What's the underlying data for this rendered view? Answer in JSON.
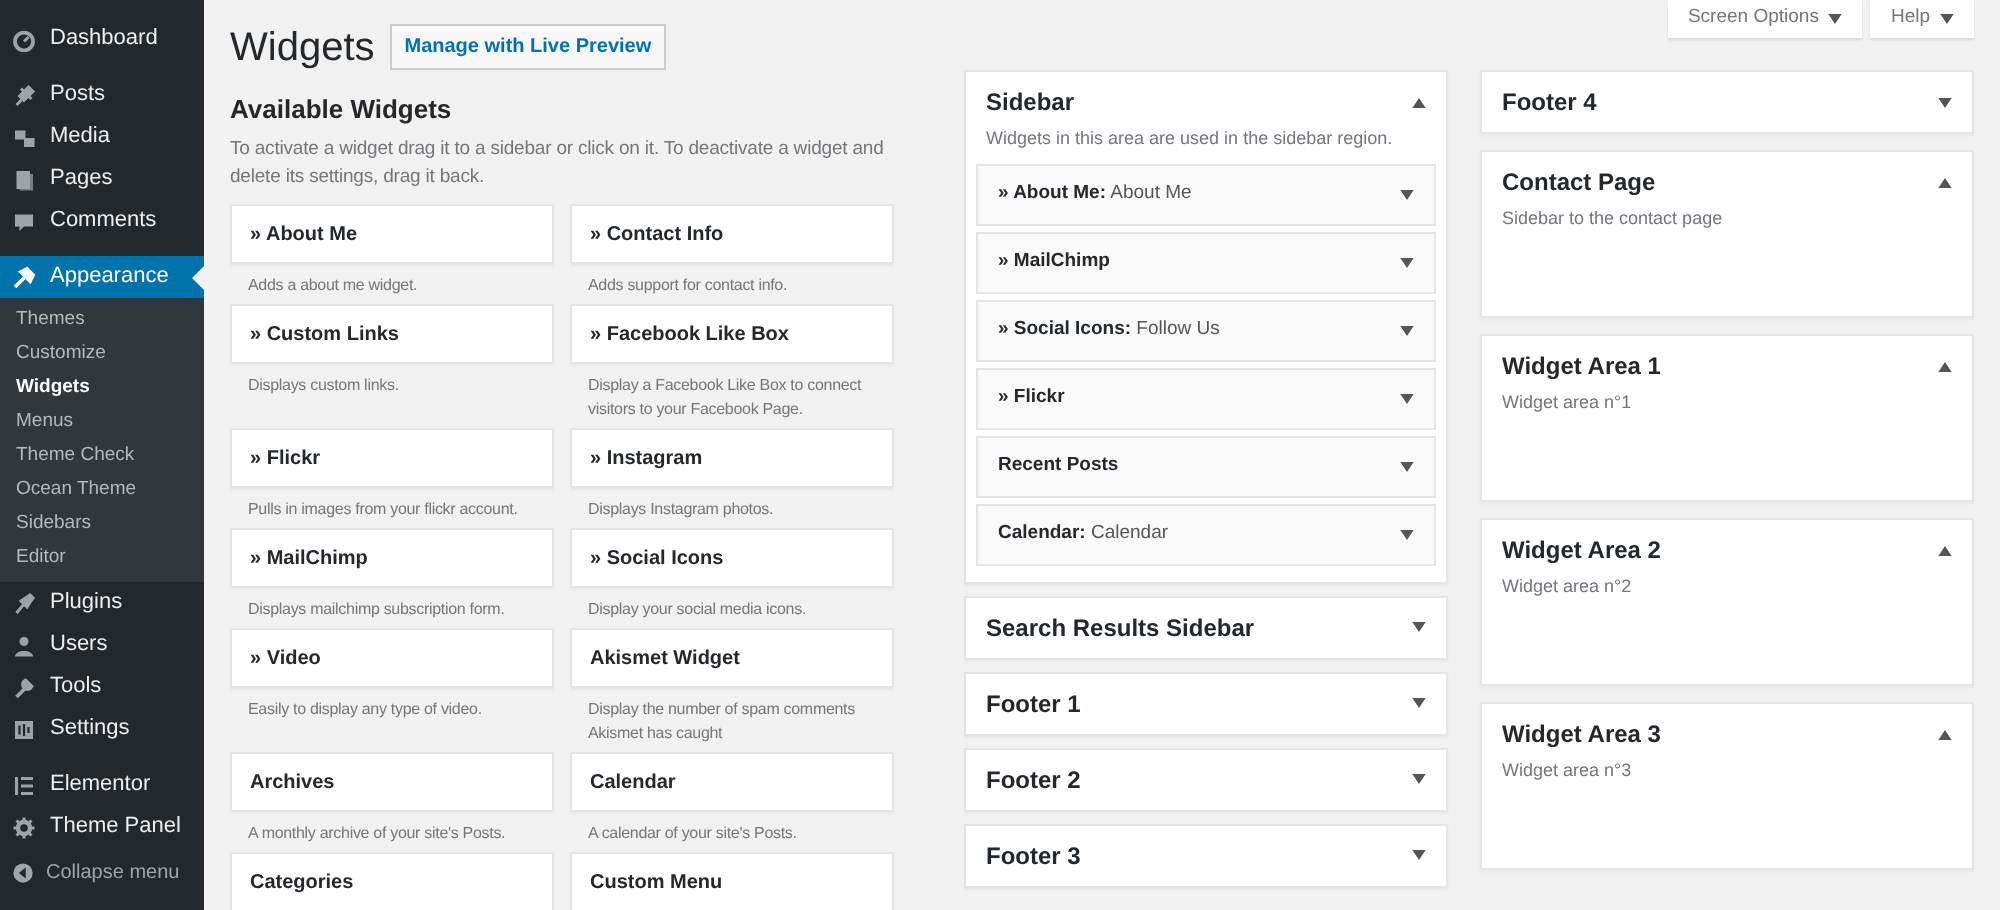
{
  "admin_menu": {
    "groups": [
      [
        {
          "label": "Dashboard",
          "selected": false
        }
      ],
      [
        {
          "label": "Posts",
          "selected": false
        },
        {
          "label": "Media",
          "selected": false
        },
        {
          "label": "Pages",
          "selected": false
        },
        {
          "label": "Comments",
          "selected": false
        }
      ],
      [
        {
          "label": "Appearance",
          "selected": true,
          "submenu": [
            {
              "label": "Themes",
              "selected": false
            },
            {
              "label": "Customize",
              "selected": false
            },
            {
              "label": "Widgets",
              "selected": true
            },
            {
              "label": "Menus",
              "selected": false
            },
            {
              "label": "Theme Check",
              "selected": false
            },
            {
              "label": "Ocean Theme",
              "selected": false
            },
            {
              "label": "Sidebars",
              "selected": false
            },
            {
              "label": "Editor",
              "selected": false
            }
          ]
        },
        {
          "label": "Plugins",
          "selected": false
        },
        {
          "label": "Users",
          "selected": false
        },
        {
          "label": "Tools",
          "selected": false
        },
        {
          "label": "Settings",
          "selected": false
        }
      ],
      [
        {
          "label": "Elementor",
          "selected": false
        },
        {
          "label": "Theme Panel",
          "selected": false
        }
      ]
    ],
    "collapse": "Collapse menu"
  },
  "screen_tabs": [
    "Screen Options",
    "Help"
  ],
  "page_title": "Widgets",
  "live_preview_button": "Manage with Live Preview",
  "available_widgets": {
    "title": "Available Widgets",
    "description": "To activate a widget drag it to a sidebar or click on it. To deactivate a widget and delete its settings, drag it back.",
    "widgets": [
      {
        "name": "» About Me",
        "description": "Adds a about me widget."
      },
      {
        "name": "» Contact Info",
        "description": "Adds support for contact info."
      },
      {
        "name": "» Custom Links",
        "description": "Displays custom links."
      },
      {
        "name": "» Facebook Like Box",
        "description": "Display a Facebook Like Box to connect visitors to your Facebook Page."
      },
      {
        "name": "» Flickr",
        "description": "Pulls in images from your flickr account."
      },
      {
        "name": "» Instagram",
        "description": "Displays Instagram photos."
      },
      {
        "name": "» MailChimp",
        "description": "Displays mailchimp subscription form."
      },
      {
        "name": "» Social Icons",
        "description": "Display your social media icons."
      },
      {
        "name": "» Video",
        "description": "Easily to display any type of video."
      },
      {
        "name": "Akismet Widget",
        "description": "Display the number of spam comments Akismet has caught"
      },
      {
        "name": "Archives",
        "description": "A monthly archive of your site's Posts."
      },
      {
        "name": "Calendar",
        "description": "A calendar of your site's Posts."
      },
      {
        "name": "Categories"
      },
      {
        "name": "Custom Menu"
      }
    ]
  },
  "widget_areas": [
    [
      {
        "title": "Sidebar",
        "expanded": true,
        "description": "Widgets in this area are used in the sidebar region.",
        "widgets": [
          {
            "name": "» About Me:",
            "title": "About Me"
          },
          {
            "name": "» MailChimp"
          },
          {
            "name": "» Social Icons:",
            "title": "Follow Us"
          },
          {
            "name": "» Flickr"
          },
          {
            "name": "Recent Posts"
          },
          {
            "name": "Calendar:",
            "title": "Calendar"
          }
        ]
      },
      {
        "title": "Search Results Sidebar",
        "expanded": false
      },
      {
        "title": "Footer 1",
        "expanded": false
      },
      {
        "title": "Footer 2",
        "expanded": false
      },
      {
        "title": "Footer 3",
        "expanded": false
      }
    ],
    [
      {
        "title": "Footer 4",
        "expanded": false
      },
      {
        "title": "Contact Page",
        "expanded": true,
        "description": "Sidebar to the contact page"
      },
      {
        "title": "Widget Area 1",
        "expanded": true,
        "description": "Widget area n°1"
      },
      {
        "title": "Widget Area 2",
        "expanded": true,
        "description": "Widget area n°2"
      },
      {
        "title": "Widget Area 3",
        "expanded": true,
        "description": "Widget area n°3"
      }
    ]
  ]
}
